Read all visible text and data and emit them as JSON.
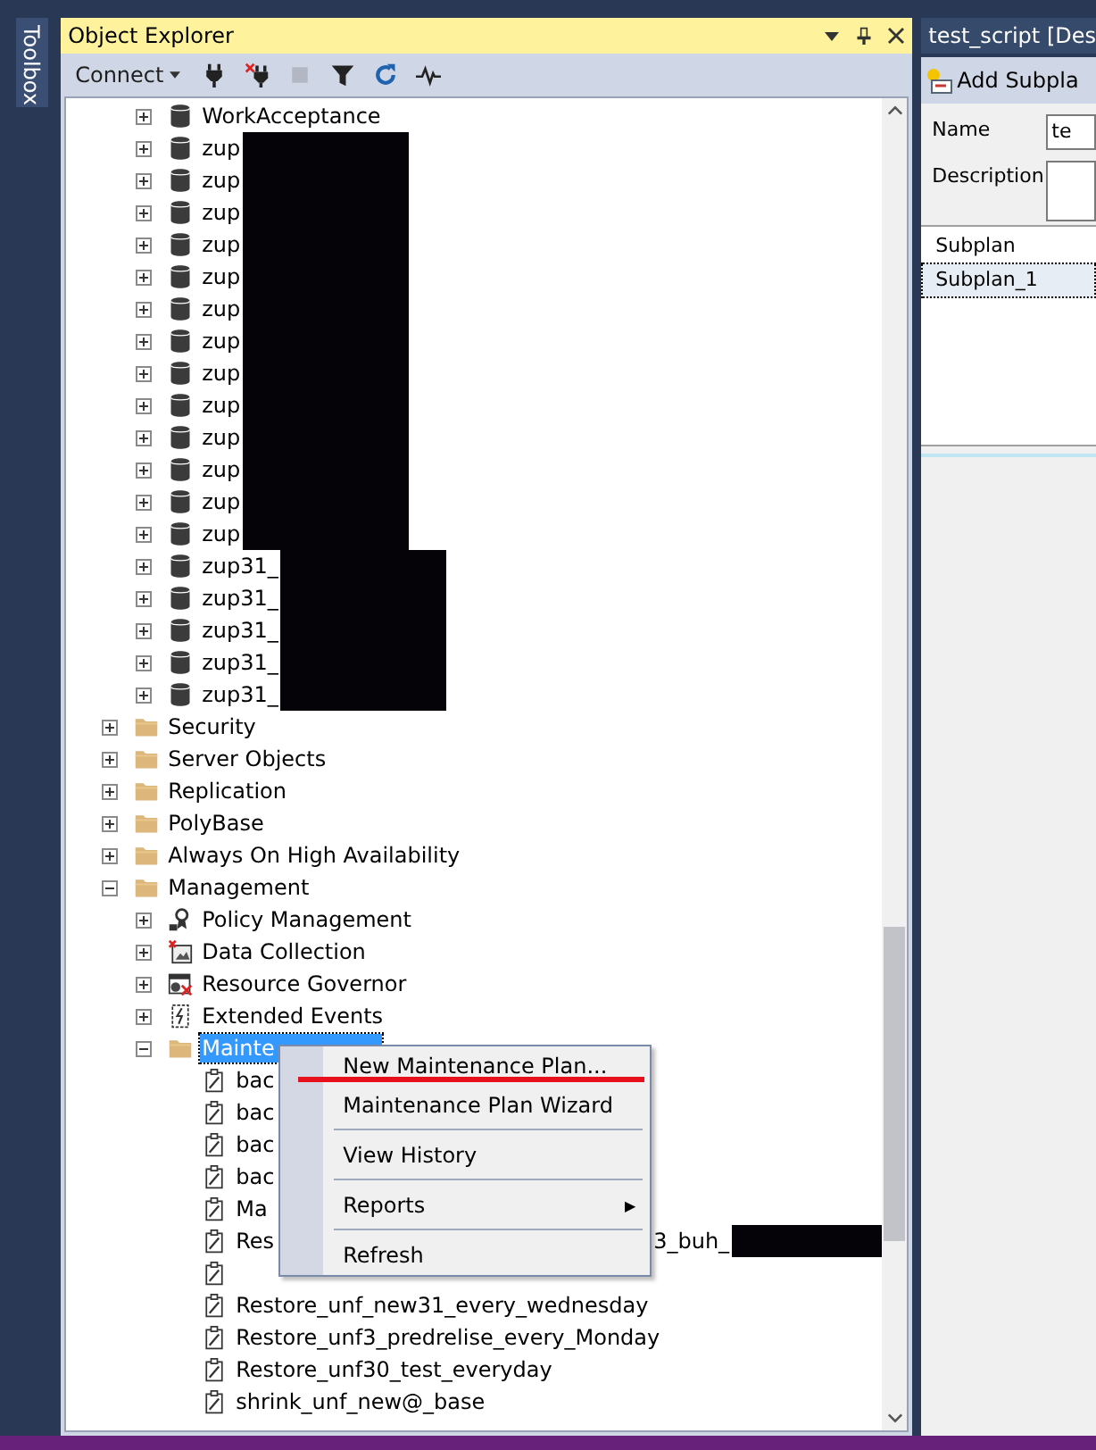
{
  "toolbox": {
    "label": "Toolbox"
  },
  "object_explorer": {
    "title": "Object Explorer",
    "toolbar": {
      "connect": "Connect",
      "buttons": [
        {
          "kind": "connect",
          "disabled": false
        },
        {
          "kind": "disconnect",
          "disabled": false
        },
        {
          "kind": "stop",
          "disabled": true
        },
        {
          "kind": "filter",
          "disabled": false
        },
        {
          "kind": "refresh",
          "disabled": false
        },
        {
          "kind": "activity",
          "disabled": false
        }
      ]
    },
    "tree": [
      {
        "kind": "continued",
        "children": [
          {
            "kind": "database",
            "label": "WorkAcceptance",
            "expanded": false
          },
          {
            "kind": "database",
            "label": "zup",
            "expanded": false,
            "redacted": true
          },
          {
            "kind": "database",
            "label": "zup",
            "expanded": false,
            "redacted": true
          },
          {
            "kind": "database",
            "label": "zup",
            "expanded": false,
            "redacted": true
          },
          {
            "kind": "database",
            "label": "zup",
            "expanded": false,
            "redacted": true
          },
          {
            "kind": "database",
            "label": "zup",
            "expanded": false,
            "redacted": true
          },
          {
            "kind": "database",
            "label": "zup",
            "expanded": false,
            "redacted": true
          },
          {
            "kind": "database",
            "label": "zup",
            "expanded": false,
            "redacted": true
          },
          {
            "kind": "database",
            "label": "zup",
            "expanded": false,
            "redacted": true
          },
          {
            "kind": "database",
            "label": "zup",
            "expanded": false,
            "redacted": true
          },
          {
            "kind": "database",
            "label": "zup",
            "expanded": false,
            "redacted": true
          },
          {
            "kind": "database",
            "label": "zup",
            "expanded": false,
            "redacted": true
          },
          {
            "kind": "database",
            "label": "zup",
            "expanded": false,
            "redacted": true
          },
          {
            "kind": "database",
            "label": "zup",
            "expanded": false,
            "redacted": true
          },
          {
            "kind": "database",
            "label": "zup31_",
            "expanded": false,
            "redacted": true
          },
          {
            "kind": "database",
            "label": "zup31_",
            "expanded": false,
            "redacted": true
          },
          {
            "kind": "database",
            "label": "zup31_",
            "expanded": false,
            "redacted": true
          },
          {
            "kind": "database",
            "label": "zup31_",
            "expanded": false,
            "redacted": true
          },
          {
            "kind": "database",
            "label": "zup31_",
            "expanded": false,
            "redacted": true
          }
        ]
      },
      {
        "kind": "folder",
        "label": "Security",
        "expanded": false
      },
      {
        "kind": "folder",
        "label": "Server Objects",
        "expanded": false
      },
      {
        "kind": "folder",
        "label": "Replication",
        "expanded": false
      },
      {
        "kind": "folder",
        "label": "PolyBase",
        "expanded": false
      },
      {
        "kind": "folder",
        "label": "Always On High Availability",
        "expanded": false
      },
      {
        "kind": "folder",
        "label": "Management",
        "expanded": true,
        "children": [
          {
            "kind": "policy",
            "label": "Policy Management",
            "expanded": false
          },
          {
            "kind": "collection",
            "label": "Data Collection",
            "expanded": false
          },
          {
            "kind": "governor",
            "label": "Resource Governor",
            "expanded": false
          },
          {
            "kind": "events",
            "label": "Extended Events",
            "expanded": false
          },
          {
            "kind": "folder",
            "label": "Mainte",
            "expanded": true,
            "selected": true,
            "children": [
              {
                "kind": "plan",
                "label": "bac"
              },
              {
                "kind": "plan",
                "label": "bac"
              },
              {
                "kind": "plan",
                "label": "bac"
              },
              {
                "kind": "plan",
                "label": "bac"
              },
              {
                "kind": "plan",
                "label": "Ma"
              },
              {
                "kind": "plan",
                "label": "Res",
                "tail": "3_buh_",
                "tail_redacted": true
              },
              {
                "kind": "plan"
              },
              {
                "kind": "plan",
                "label": "Restore_unf_new31_every_wednesday"
              },
              {
                "kind": "plan",
                "label": "Restore_unf3_predrelise_every_Monday"
              },
              {
                "kind": "plan",
                "label": "Restore_unf30_test_everyday"
              },
              {
                "kind": "plan",
                "label": "shrink_unf_new@_base"
              }
            ]
          }
        ]
      }
    ],
    "context_menu": [
      {
        "kind": "item",
        "label": "New Maintenance Plan...",
        "underlined": true
      },
      {
        "kind": "item",
        "label": "Maintenance Plan Wizard",
        "underlined": false
      },
      {
        "kind": "separator"
      },
      {
        "kind": "item",
        "label": "View History",
        "underlined": false
      },
      {
        "kind": "separator"
      },
      {
        "kind": "submenu",
        "label": "Reports",
        "arrow": "▶",
        "underlined": false
      },
      {
        "kind": "separator"
      },
      {
        "kind": "item",
        "label": "Refresh",
        "underlined": false
      }
    ]
  },
  "designer": {
    "title": "test_script [Des",
    "toolbar": {
      "add_subplan": "Add Subpla"
    },
    "name_label": "Name",
    "name_value": "te",
    "description_label": "Description",
    "grid": {
      "header": "Subplan",
      "rows": [
        {
          "label": "Subplan_1",
          "selected": true
        }
      ]
    }
  }
}
